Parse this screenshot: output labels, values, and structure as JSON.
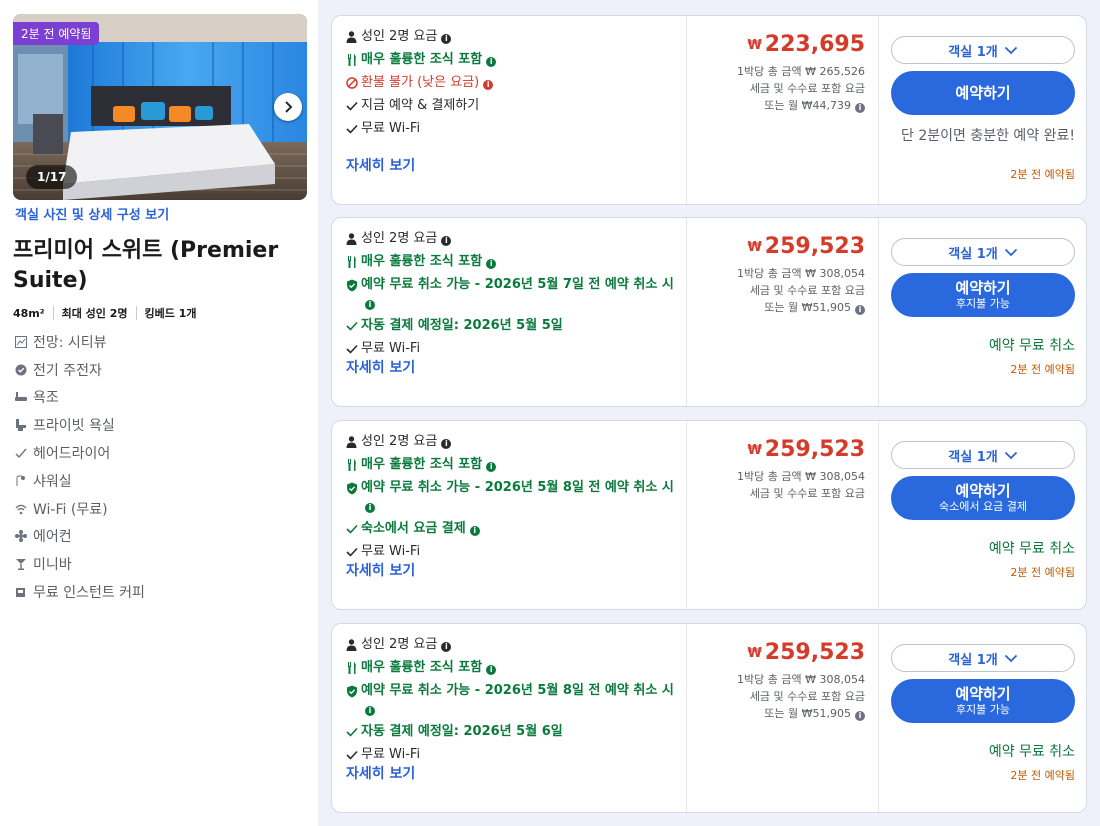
{
  "room": {
    "photo_badge": "2분 전 예약됨",
    "photo_counter": "1/17",
    "photo_link": "객실 사진 및 상세 구성 보기",
    "title": "프리미어 스위트 (Premier Suite)",
    "meta": [
      "48m²",
      "최대 성인 2명",
      "킹베드 1개"
    ],
    "features": [
      {
        "icon": "view-icon",
        "label": "전망: 시티뷰"
      },
      {
        "icon": "kettle-icon",
        "label": "전기 주전자"
      },
      {
        "icon": "bathtub-icon",
        "label": "욕조"
      },
      {
        "icon": "private-bathroom-icon",
        "label": "프라이빗 욕실"
      },
      {
        "icon": "hairdryer-icon",
        "label": "헤어드라이어"
      },
      {
        "icon": "shower-icon",
        "label": "샤워실"
      },
      {
        "icon": "wifi-icon",
        "label": "Wi-Fi (무료)"
      },
      {
        "icon": "aircon-icon",
        "label": "에어컨"
      },
      {
        "icon": "minibar-icon",
        "label": "미니바"
      },
      {
        "icon": "coffee-icon",
        "label": "무료 인스턴트 커피"
      }
    ]
  },
  "colors": {
    "accent_blue": "#2a68dd",
    "price_red": "#d43b2b",
    "green": "#0a7a3c",
    "booked_orange": "#c25a06",
    "badge_purple": "#7b3fd4"
  },
  "offers": [
    {
      "occupancy": "성인 2명 요금",
      "breakfast": "매우 훌륭한 조식 포함",
      "policy": "환불 불가 (낮은 요금)",
      "payment": "지금 예약 & 결제하기",
      "wifi": "무료 Wi-Fi",
      "details": "자세히 보기",
      "currency": "₩",
      "price": "223,695",
      "per_night": "1박당 총 금액 ₩ 265,526",
      "taxes": "세금 및 수수료 포함 요금",
      "monthly": "또는 월 ₩44,739",
      "room_select": "객실 1개",
      "book": "예약하기",
      "book_sub": "",
      "note": "단 2분이면 충분한 예약 완료!",
      "booked": "2분 전 예약됨"
    },
    {
      "occupancy": "성인 2명 요금",
      "breakfast": "매우 훌륭한 조식 포함",
      "policy": "예약 무료 취소 가능 - 2026년 5월 7일 전 예약 취소 시",
      "payment": "자동 결제 예정일: 2026년 5월 5일",
      "wifi": "무료 Wi-Fi",
      "details": "자세히 보기",
      "currency": "₩",
      "price": "259,523",
      "per_night": "1박당 총 금액 ₩ 308,054",
      "taxes": "세금 및 수수료 포함 요금",
      "monthly": "또는 월 ₩51,905",
      "room_select": "객실 1개",
      "book": "예약하기",
      "book_sub": "후지불 가능",
      "note": "예약 무료 취소",
      "booked": "2분 전 예약됨"
    },
    {
      "occupancy": "성인 2명 요금",
      "breakfast": "매우 훌륭한 조식 포함",
      "policy": "예약 무료 취소 가능 - 2026년 5월 8일 전 예약 취소 시",
      "payment": "숙소에서 요금 결제",
      "wifi": "무료 Wi-Fi",
      "details": "자세히 보기",
      "currency": "₩",
      "price": "259,523",
      "per_night": "1박당 총 금액 ₩ 308,054",
      "taxes": "세금 및 수수료 포함 요금",
      "monthly": "",
      "room_select": "객실 1개",
      "book": "예약하기",
      "book_sub": "숙소에서 요금 결제",
      "note": "예약 무료 취소",
      "booked": "2분 전 예약됨"
    },
    {
      "occupancy": "성인 2명 요금",
      "breakfast": "매우 훌륭한 조식 포함",
      "policy": "예약 무료 취소 가능 - 2026년 5월 8일 전 예약 취소 시",
      "payment": "자동 결제 예정일: 2026년 5월 6일",
      "wifi": "무료 Wi-Fi",
      "details": "자세히 보기",
      "currency": "₩",
      "price": "259,523",
      "per_night": "1박당 총 금액 ₩ 308,054",
      "taxes": "세금 및 수수료 포함 요금",
      "monthly": "또는 월 ₩51,905",
      "room_select": "객실 1개",
      "book": "예약하기",
      "book_sub": "후지불 가능",
      "note": "예약 무료 취소",
      "booked": "2분 전 예약됨"
    }
  ]
}
